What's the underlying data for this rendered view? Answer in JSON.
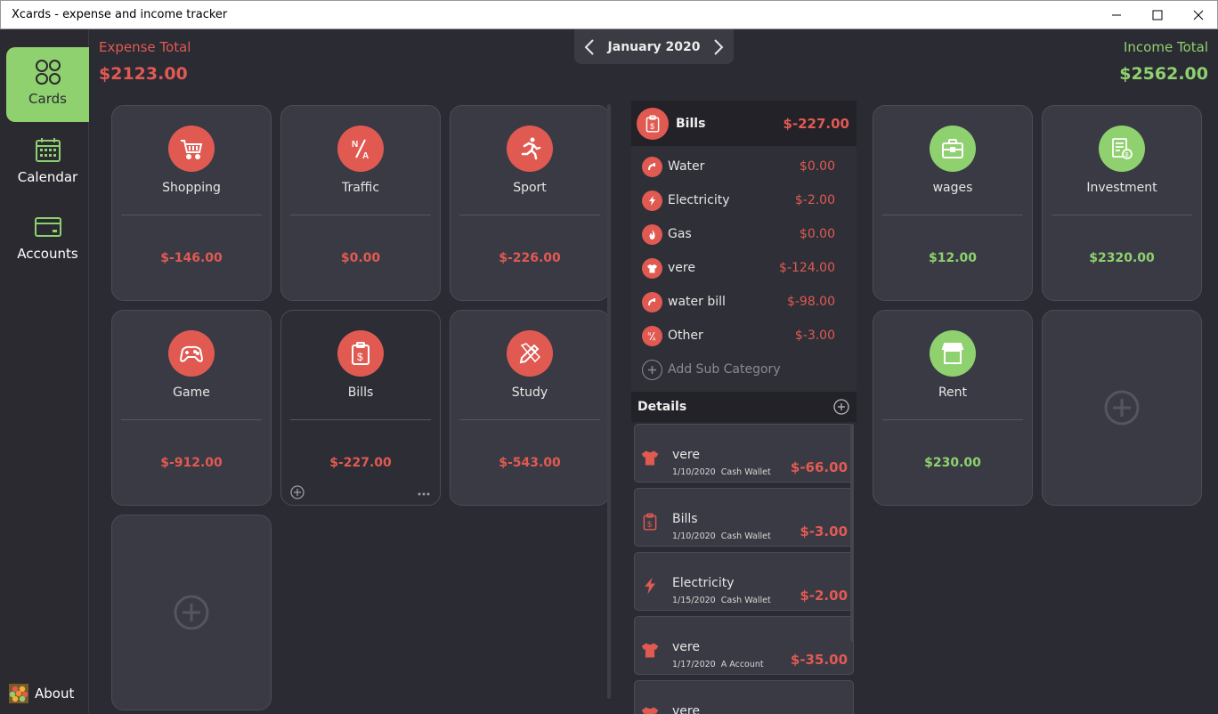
{
  "window": {
    "title": "Xcards - expense and income tracker"
  },
  "sidebar": {
    "items": [
      {
        "label": "Cards",
        "icon": "cards-icon",
        "active": true
      },
      {
        "label": "Calendar",
        "icon": "calendar-icon",
        "active": false
      },
      {
        "label": "Accounts",
        "icon": "card-icon",
        "active": false
      }
    ],
    "about_label": "About"
  },
  "header": {
    "expense_label": "Expense Total",
    "expense_value": "$2123.00",
    "income_label": "Income Total",
    "income_value": "$2562.00",
    "month": "January 2020"
  },
  "colors": {
    "expense": "#e05a52",
    "income": "#8fd16e",
    "background": "#2b2b33"
  },
  "expense_cards": [
    {
      "name": "Shopping",
      "amount": "$-146.00",
      "icon": "cart-icon"
    },
    {
      "name": "Traffic",
      "amount": "$0.00",
      "icon": "na-icon"
    },
    {
      "name": "Sport",
      "amount": "$-226.00",
      "icon": "runner-icon"
    },
    {
      "name": "Game",
      "amount": "$-912.00",
      "icon": "gamepad-icon"
    },
    {
      "name": "Bills",
      "amount": "$-227.00",
      "icon": "bill-icon",
      "selected": true
    },
    {
      "name": "Study",
      "amount": "$-543.00",
      "icon": "pencil-ruler-icon"
    }
  ],
  "income_cards": [
    {
      "name": "wages",
      "amount": "$12.00",
      "icon": "briefcase-icon"
    },
    {
      "name": "Investment",
      "amount": "$2320.00",
      "icon": "invoice-icon"
    },
    {
      "name": "Rent",
      "amount": "$230.00",
      "icon": "store-icon"
    }
  ],
  "category_panel": {
    "name": "Bills",
    "total": "$-227.00",
    "subcategories": [
      {
        "name": "Water",
        "amount": "$0.00",
        "icon": "faucet-icon"
      },
      {
        "name": "Electricity",
        "amount": "$-2.00",
        "icon": "bolt-icon"
      },
      {
        "name": "Gas",
        "amount": "$0.00",
        "icon": "flame-icon"
      },
      {
        "name": "vere",
        "amount": "$-124.00",
        "icon": "shirt-icon"
      },
      {
        "name": "water bill",
        "amount": "$-98.00",
        "icon": "faucet-icon"
      },
      {
        "name": "Other",
        "amount": "$-3.00",
        "icon": "na-icon"
      }
    ],
    "add_sub_label": "Add Sub Category",
    "details_label": "Details",
    "entries": [
      {
        "title": "vere",
        "date": "1/10/2020",
        "account": "Cash Wallet",
        "amount": "$-66.00",
        "icon": "shirt-icon"
      },
      {
        "title": "Bills",
        "date": "1/10/2020",
        "account": "Cash Wallet",
        "amount": "$-3.00",
        "icon": "bill-icon"
      },
      {
        "title": "Electricity",
        "date": "1/15/2020",
        "account": "Cash Wallet",
        "amount": "$-2.00",
        "icon": "bolt-icon"
      },
      {
        "title": "vere",
        "date": "1/17/2020",
        "account": "A Account",
        "amount": "$-35.00",
        "icon": "shirt-icon"
      },
      {
        "title": "vere",
        "date": "",
        "account": "",
        "amount": "",
        "icon": "shirt-icon"
      }
    ]
  }
}
